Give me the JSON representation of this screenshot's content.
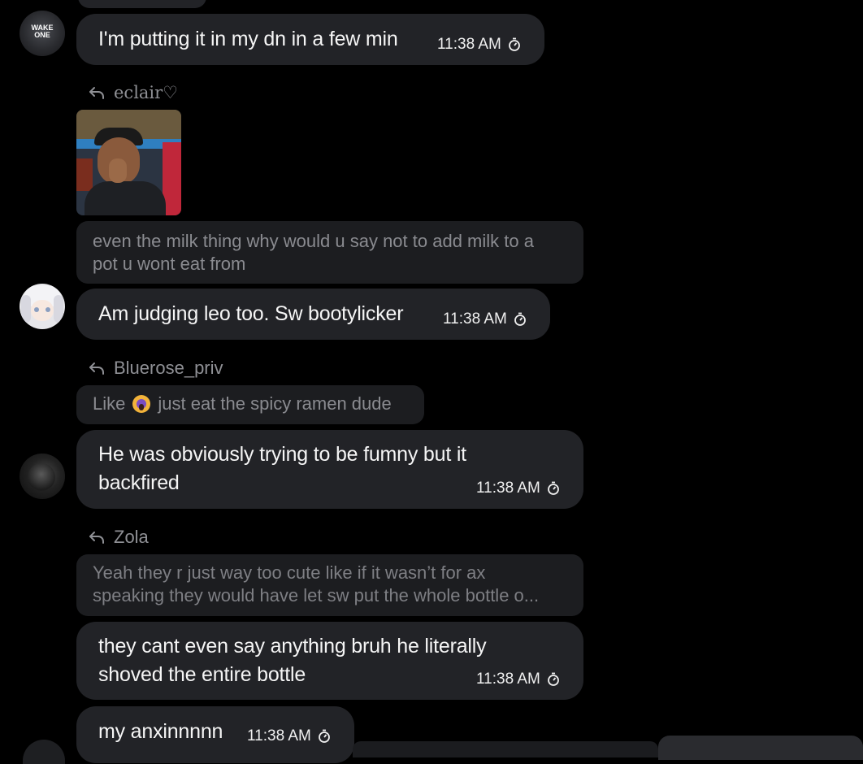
{
  "avatars": {
    "wake_one_text": "WAKE ONE"
  },
  "messages": [
    {
      "text": "I'm putting it in my dn in a few min",
      "time": "11:38 AM"
    },
    {
      "text": "Am judging leo too. Sw bootylicker",
      "time": "11:38 AM"
    },
    {
      "line1": "He was obviously trying to be fumny but it",
      "line2": "backfired",
      "time": "11:38 AM"
    },
    {
      "line1": "they cant even say anything bruh he literally",
      "line2": "shoved the entire bottle",
      "time": "11:38 AM"
    },
    {
      "text": "my anxinnnnn",
      "time": "11:38 AM"
    }
  ],
  "replies": [
    {
      "author": "eclair♡",
      "line1": "even the milk thing why would u say not to add milk to a",
      "line2": "pot u wont eat from"
    },
    {
      "author": "Bluerose_priv",
      "text_before_emoji": "Like",
      "text_after_emoji": "just eat the spicy ramen dude"
    },
    {
      "author": "Zola",
      "line1": "Yeah they r just way too cute like if it wasn’t for ax",
      "line2": "speaking they would have let sw put the whole bottle o..."
    }
  ],
  "colors": {
    "background": "#000000",
    "bubble": "#222327",
    "quote": "#1c1d20",
    "muted_text": "#8a8b90"
  }
}
